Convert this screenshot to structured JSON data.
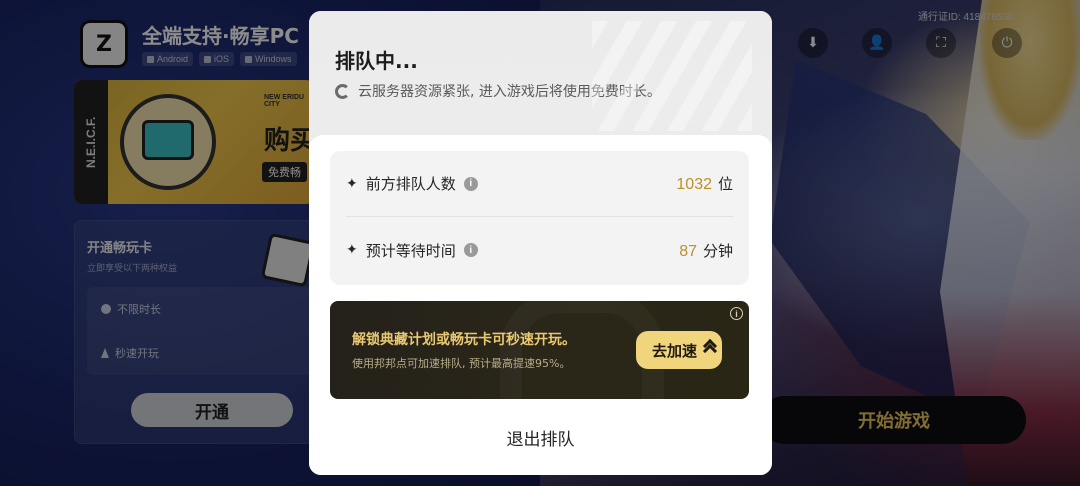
{
  "background": {
    "app_title": "全端支持·畅享PC",
    "platforms": [
      "Android",
      "iOS",
      "Windows"
    ],
    "banner": {
      "side_text": "N.E.I.C.F.",
      "city_text": "NEW ERIDU CITY",
      "headline": "购买",
      "subline": "免费畅"
    },
    "member_card": {
      "title": "开通畅玩卡",
      "subtitle": "立即享受以下两种权益",
      "perks": [
        "不限时长",
        "秒速开玩"
      ],
      "button_label": "开通"
    },
    "pass_id": "通行证ID: 418476530",
    "start_button_label": "开始游戏",
    "top_icons": [
      "download-icon",
      "user-icon",
      "scan-icon",
      "logout-icon"
    ]
  },
  "modal": {
    "title": "排队中...",
    "notice": "云服务器资源紧张, 进入游戏后将使用免费时长。",
    "stats": [
      {
        "label": "前方排队人数",
        "value": "1032",
        "unit": "位"
      },
      {
        "label": "预计等待时间",
        "value": "87",
        "unit": "分钟"
      }
    ],
    "speedup": {
      "title": "解锁典藏计划或畅玩卡可秒速开玩。",
      "subtitle": "使用邦邦点可加速排队, 预计最高提速95%。",
      "button_label": "去加速"
    },
    "exit_label": "退出排队"
  },
  "colors": {
    "accent_gold": "#b8912c",
    "speed_title": "#e9c872",
    "speed_button": "#f1d57d",
    "start_button_text": "#e9c560"
  }
}
